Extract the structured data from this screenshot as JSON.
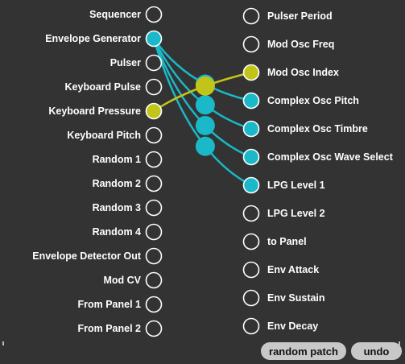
{
  "sources": [
    "Sequencer",
    "Envelope Generator",
    "Pulser",
    "Keyboard Pulse",
    "Keyboard Pressure",
    "Keyboard Pitch",
    "Random 1",
    "Random 2",
    "Random 3",
    "Random 4",
    "Envelope Detector Out",
    "Mod CV",
    "From Panel 1",
    "From Panel 2"
  ],
  "destinations": [
    "Pulser Period",
    "Mod Osc Freq",
    "Mod Osc Index",
    "Complex Osc Pitch",
    "Complex Osc Timbre",
    "Complex Osc Wave Select",
    "LPG Level 1",
    "LPG Level 2",
    "to Panel",
    "Env Attack",
    "Env Sustain",
    "Env Decay"
  ],
  "connections": [
    {
      "source": 1,
      "dest": 4,
      "color": "#1ab8c8"
    },
    {
      "source": 1,
      "dest": 5,
      "color": "#1ab8c8"
    },
    {
      "source": 1,
      "dest": 6,
      "color": "#1ab8c8"
    },
    {
      "source": 1,
      "dest": 3,
      "color": "#1ab8c8"
    },
    {
      "source": 4,
      "dest": 2,
      "color": "#c3c41a"
    }
  ],
  "colors": {
    "background": "#333333",
    "jack_ring": "#ffffff",
    "teal": "#1ab8c8",
    "yellow": "#c3c41a",
    "button_bg": "#c8c8c8"
  },
  "buttons": {
    "random_patch": "random patch",
    "undo": "undo"
  }
}
